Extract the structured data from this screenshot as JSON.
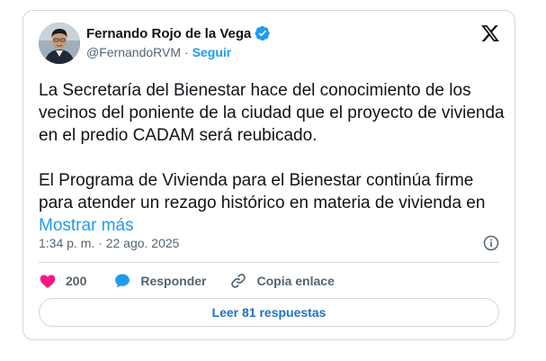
{
  "author": {
    "display_name": "Fernando Rojo de la Vega",
    "handle": "@FernandoRVM",
    "separator": "·",
    "follow_label": "Seguir",
    "verified": true
  },
  "tweet": {
    "paragraph_1": "La Secretaría del Bienestar hace del conocimiento de los vecinos del poniente de la ciudad que el proyecto de vivienda en el predio CADAM será reubicado.",
    "paragraph_2": "El Programa de Vivienda para el Bienestar continúa firme para atender un rezago histórico en materia de vivienda en",
    "show_more": "Mostrar más",
    "timestamp": "1:34 p. m. · 22 ago. 2025"
  },
  "actions": {
    "like_count": "200",
    "reply_label": "Responder",
    "copy_link_label": "Copia enlace"
  },
  "read_replies_label": "Leer 81 respuestas",
  "icons": {
    "verified": "verified-badge-icon",
    "platform": "x-logo-icon",
    "info": "info-icon",
    "like": "heart-icon",
    "reply": "speech-bubble-icon",
    "link": "link-icon"
  },
  "colors": {
    "accent": "#1d9bf0",
    "like": "#f91880",
    "text": "#0f1419",
    "secondary": "#536471",
    "border": "#cfd9de"
  }
}
